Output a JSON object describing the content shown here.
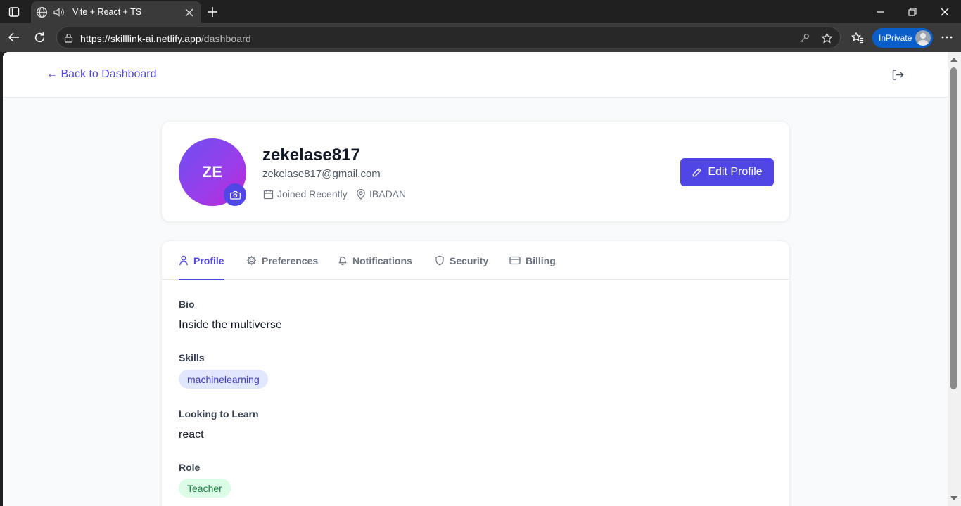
{
  "browser": {
    "tab_title": "Vite + React + TS",
    "url_host": "https://skilllink-ai.netlify.app",
    "url_path": "/dashboard",
    "inprivate_label": "InPrivate"
  },
  "header": {
    "back_label": "← Back to Dashboard"
  },
  "profile": {
    "initials": "ZE",
    "username": "zekelase817",
    "email": "zekelase817@gmail.com",
    "joined": "Joined Recently",
    "location": "IBADAN",
    "edit_label": "Edit Profile"
  },
  "tabs": [
    {
      "label": "Profile",
      "icon": "user-icon",
      "active": true
    },
    {
      "label": "Preferences",
      "icon": "gear-icon",
      "active": false
    },
    {
      "label": "Notifications",
      "icon": "bell-icon",
      "active": false
    },
    {
      "label": "Security",
      "icon": "shield-icon",
      "active": false
    },
    {
      "label": "Billing",
      "icon": "credit-card-icon",
      "active": false
    }
  ],
  "fields": {
    "bio_label": "Bio",
    "bio_value": "Inside the multiverse",
    "skills_label": "Skills",
    "skills": [
      "machinelearning"
    ],
    "learn_label": "Looking to Learn",
    "learn_value": "react",
    "role_label": "Role",
    "role_value": "Teacher"
  },
  "colors": {
    "accent": "#4f46e5",
    "role_chip_bg": "#dcfce7",
    "skill_chip_bg": "#e0e7ff"
  }
}
